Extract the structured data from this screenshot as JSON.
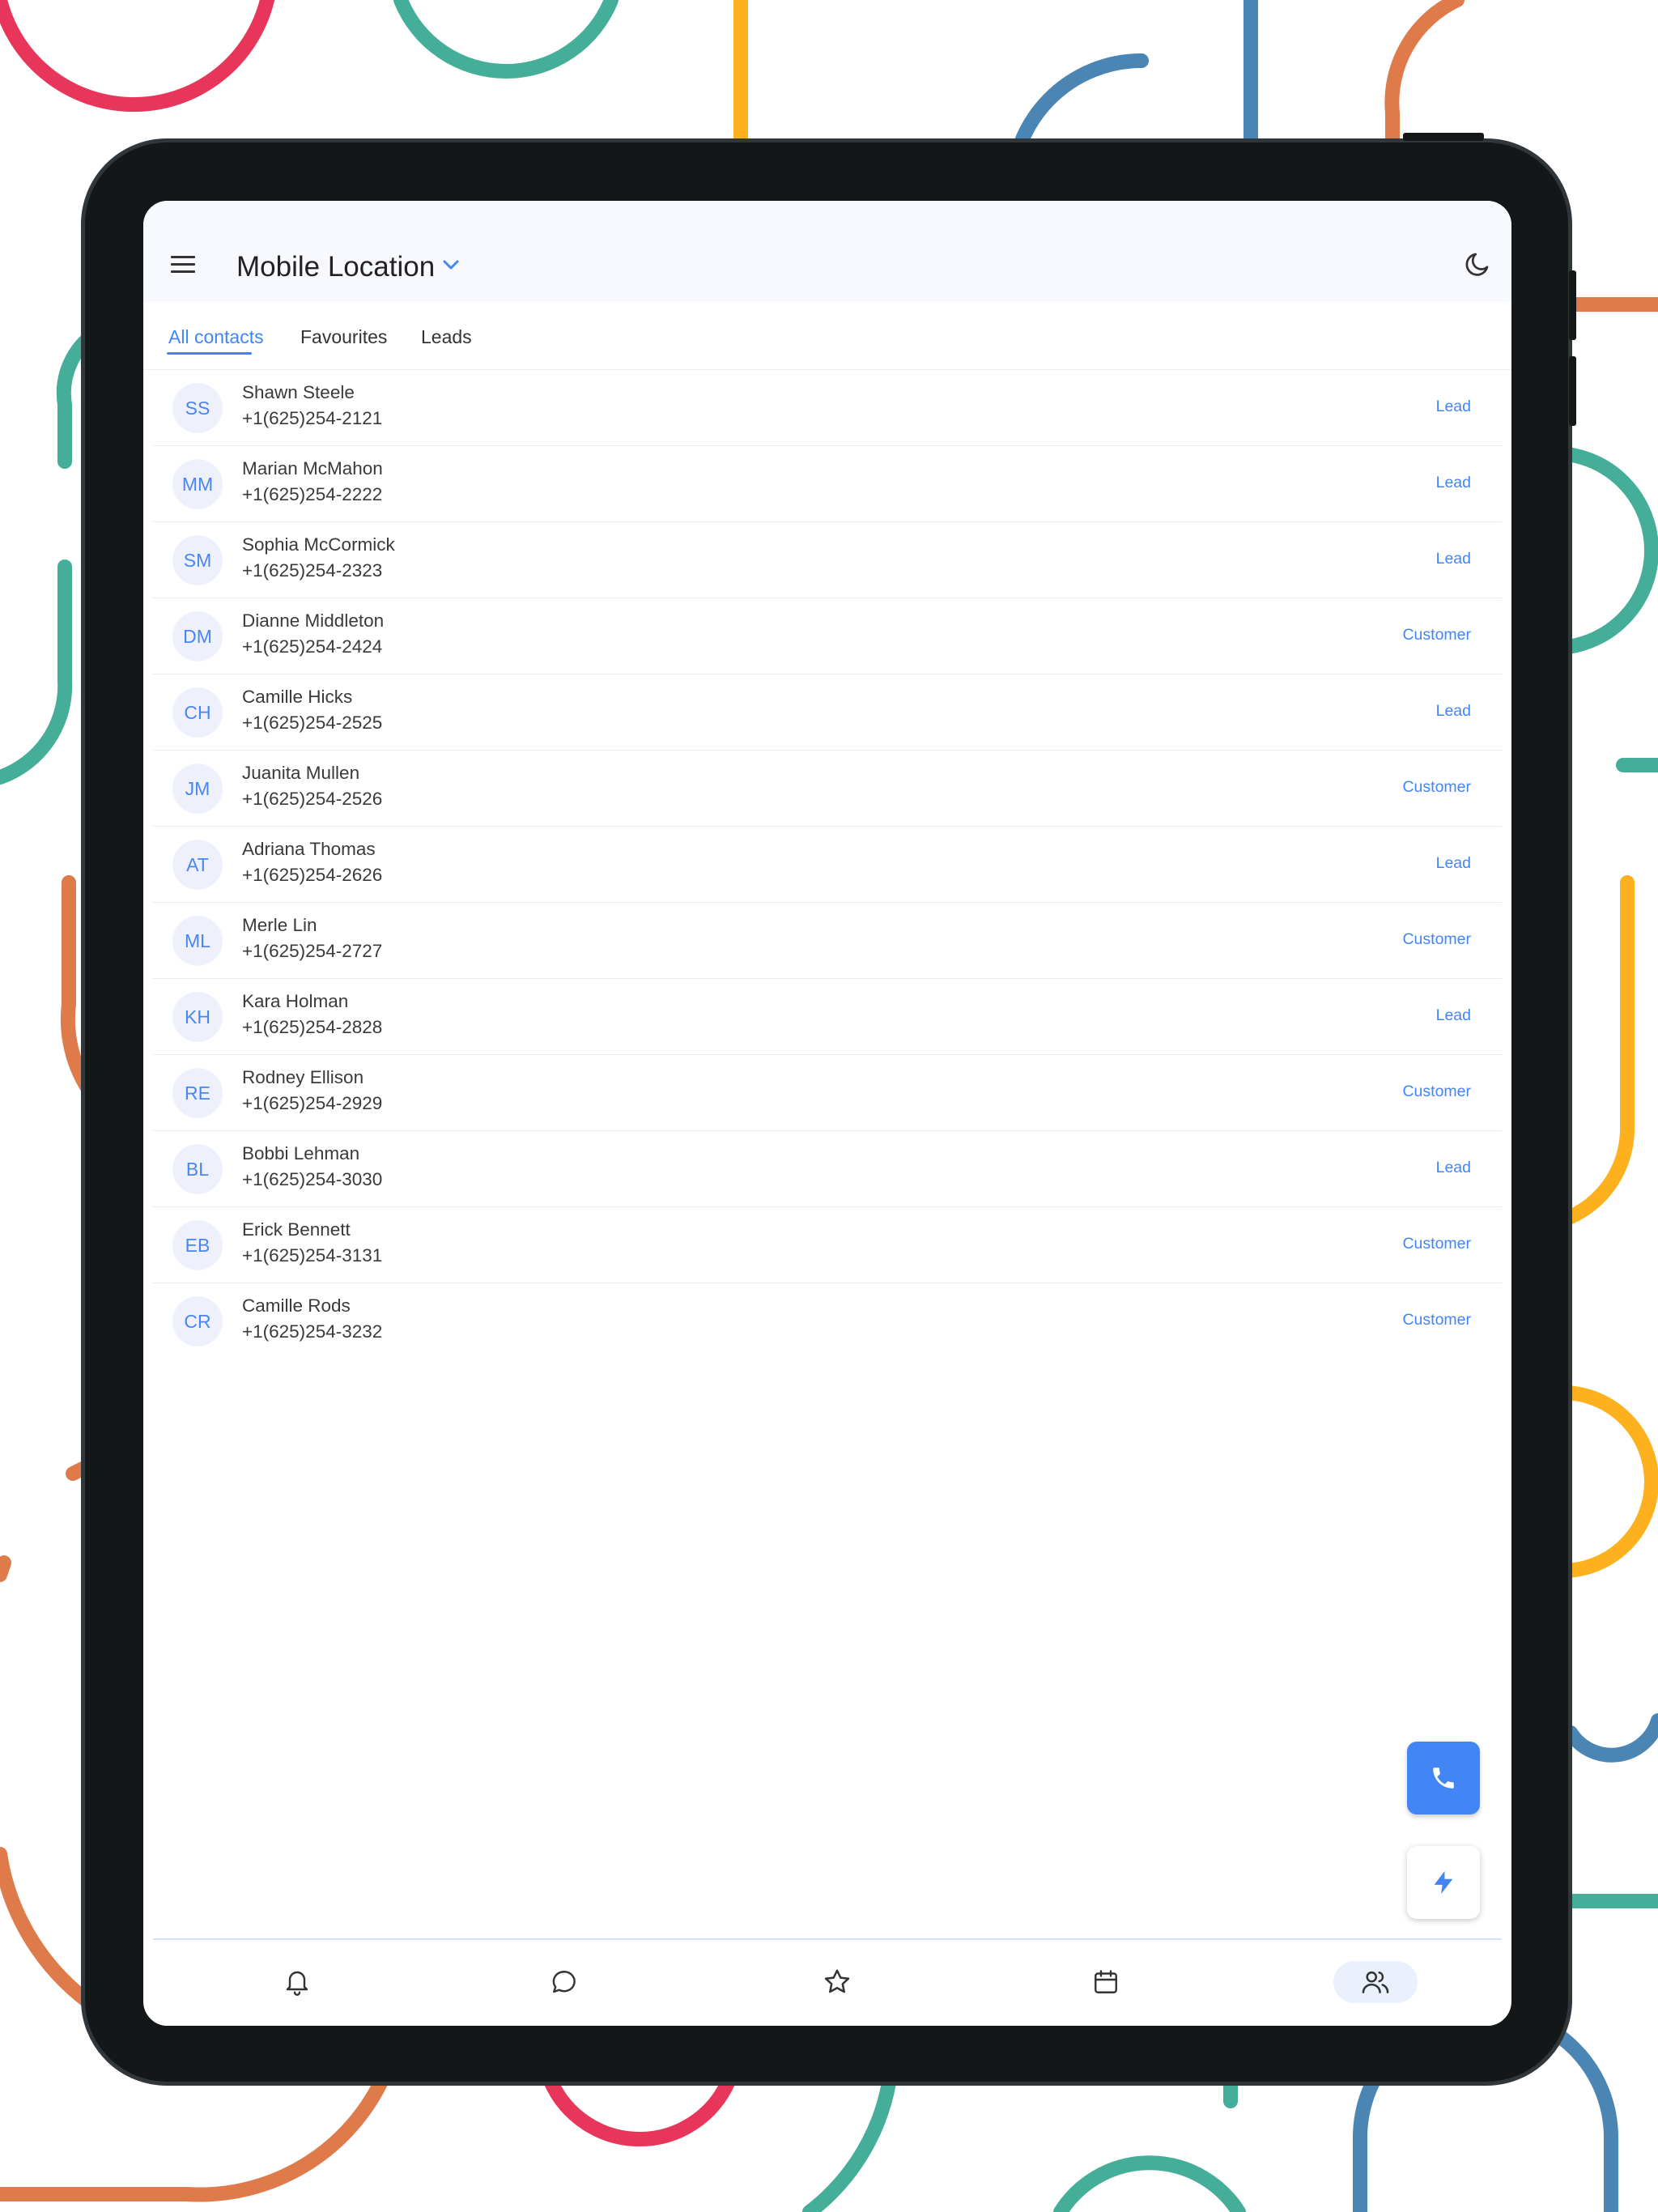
{
  "app": {
    "title": "Mobile Location"
  },
  "tabs": [
    {
      "label": "All contacts",
      "active": true
    },
    {
      "label": "Favourites",
      "active": false
    },
    {
      "label": "Leads",
      "active": false
    }
  ],
  "contacts": [
    {
      "initials": "SS",
      "name": "Shawn Steele",
      "phone": "+1(625)254-2121",
      "tag": "Lead"
    },
    {
      "initials": "MM",
      "name": "Marian McMahon",
      "phone": "+1(625)254-2222",
      "tag": "Lead"
    },
    {
      "initials": "SM",
      "name": "Sophia McCormick",
      "phone": "+1(625)254-2323",
      "tag": "Lead"
    },
    {
      "initials": "DM",
      "name": "Dianne Middleton",
      "phone": "+1(625)254-2424",
      "tag": "Customer"
    },
    {
      "initials": "CH",
      "name": "Camille Hicks",
      "phone": "+1(625)254-2525",
      "tag": "Lead"
    },
    {
      "initials": "JM",
      "name": "Juanita Mullen",
      "phone": "+1(625)254-2526",
      "tag": "Customer"
    },
    {
      "initials": "AT",
      "name": "Adriana Thomas",
      "phone": "+1(625)254-2626",
      "tag": "Lead"
    },
    {
      "initials": "ML",
      "name": "Merle Lin",
      "phone": "+1(625)254-2727",
      "tag": "Customer"
    },
    {
      "initials": "KH",
      "name": "Kara Holman",
      "phone": "+1(625)254-2828",
      "tag": "Lead"
    },
    {
      "initials": "RE",
      "name": "Rodney Ellison",
      "phone": "+1(625)254-2929",
      "tag": "Customer"
    },
    {
      "initials": "BL",
      "name": "Bobbi Lehman",
      "phone": "+1(625)254-3030",
      "tag": "Lead"
    },
    {
      "initials": "EB",
      "name": "Erick Bennett",
      "phone": "+1(625)254-3131",
      "tag": "Customer"
    },
    {
      "initials": "CR",
      "name": "Camille Rods",
      "phone": "+1(625)254-3232",
      "tag": "Customer"
    }
  ],
  "icons": {
    "menu": "menu-icon",
    "title_dropdown": "chevron-down-icon",
    "theme_toggle": "moon-icon",
    "fab_call": "phone-icon",
    "fab_quick": "lightning-icon"
  },
  "bottom_nav": [
    {
      "icon": "bell-icon",
      "active": false
    },
    {
      "icon": "chat-icon",
      "active": false
    },
    {
      "icon": "star-icon",
      "active": false
    },
    {
      "icon": "calendar-icon",
      "active": false
    },
    {
      "icon": "users-icon",
      "active": true
    }
  ],
  "colors": {
    "accent": "#4285f4",
    "header_bg": "#f7f9fe",
    "avatar_bg": "#eef1fb",
    "device_frame": "#131718",
    "decor_red": "#e8365a",
    "decor_teal": "#45ae98",
    "decor_yellow": "#fdb11e",
    "decor_blue": "#4a85b4",
    "decor_orange": "#df7a4a"
  }
}
